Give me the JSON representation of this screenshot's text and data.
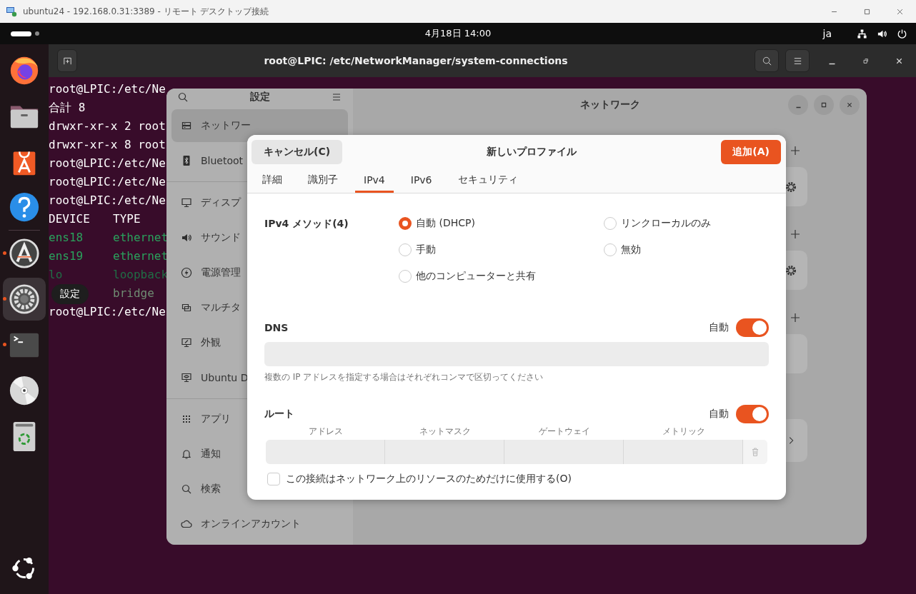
{
  "rdp_window": {
    "title": "ubuntu24 - 192.168.0.31:3389 - リモート デスクトップ接続"
  },
  "top_bar": {
    "clock": "4月18日 14:00",
    "input_method": "ja"
  },
  "dock": {
    "items": [
      {
        "kind": "firefox",
        "running": false,
        "selected": false
      },
      {
        "kind": "files",
        "running": false,
        "selected": false
      },
      {
        "kind": "app-center",
        "running": false,
        "selected": false
      },
      {
        "kind": "help",
        "running": false,
        "selected": false
      },
      {
        "kind": "updater",
        "running": true,
        "selected": false
      },
      {
        "kind": "settings",
        "running": true,
        "selected": true
      },
      {
        "kind": "terminal",
        "running": true,
        "selected": false
      },
      {
        "kind": "disc",
        "running": false,
        "selected": false
      },
      {
        "kind": "trash",
        "running": false,
        "selected": false
      }
    ],
    "tooltip": "設定"
  },
  "terminal": {
    "title": "root@LPIC: /etc/NetworkManager/system-connections",
    "lines": [
      {
        "kind": "text",
        "text": "root@LPIC:/etc/Ne"
      },
      {
        "kind": "text",
        "text": "合計 8"
      },
      {
        "kind": "text",
        "text": "drwxr-xr-x 2 root"
      },
      {
        "kind": "text",
        "text": "drwxr-xr-x 8 root"
      },
      {
        "kind": "text",
        "text": "root@LPIC:/etc/Ne"
      },
      {
        "kind": "text",
        "text": "root@LPIC:/etc/Ne"
      },
      {
        "kind": "text",
        "text": "root@LPIC:/etc/Ne"
      },
      {
        "kind": "row",
        "device": "DEVICE",
        "type": "TYPE"
      },
      {
        "kind": "row",
        "device": "ens18",
        "type": "ethernet",
        "color": "#2aa15c"
      },
      {
        "kind": "row",
        "device": "ens19",
        "type": "ethernet",
        "color": "#2aa15c"
      },
      {
        "kind": "row",
        "device": "lo",
        "type": "loopback",
        "color": "#1f6e45"
      },
      {
        "kind": "row",
        "type": "bridge",
        "color": "#6f8c72"
      },
      {
        "kind": "text",
        "text": "root@LPIC:/etc/Ne"
      }
    ]
  },
  "settings": {
    "title": "設定",
    "page_title": "ネットワーク",
    "sidebar": {
      "sections": [
        {
          "items": [
            {
              "kind": "network",
              "label": "ネットワー",
              "selected": true
            },
            {
              "kind": "bluetooth",
              "label": "Bluetoot",
              "selected": false
            }
          ]
        },
        {
          "items": [
            {
              "kind": "display",
              "label": "ディスプ",
              "selected": false
            },
            {
              "kind": "sound",
              "label": "サウンド",
              "selected": false
            },
            {
              "kind": "power",
              "label": "電源管理",
              "selected": false
            },
            {
              "kind": "multitask",
              "label": "マルチタ",
              "selected": false
            },
            {
              "kind": "appearance",
              "label": "外観",
              "selected": false
            },
            {
              "kind": "desktop",
              "label": "Ubuntu D",
              "selected": false
            }
          ]
        },
        {
          "items": [
            {
              "kind": "apps",
              "label": "アプリ",
              "selected": false
            },
            {
              "kind": "notifications",
              "label": "通知",
              "selected": false
            },
            {
              "kind": "search",
              "label": "検索",
              "selected": false
            },
            {
              "kind": "online",
              "label": "オンラインアカウント",
              "selected": false
            }
          ]
        }
      ]
    },
    "cards": [
      {
        "kind": "gear"
      },
      {
        "kind": "gear"
      },
      {
        "kind": "plain"
      },
      {
        "kind": "chevron"
      }
    ]
  },
  "dialog": {
    "cancel": "キャンセル(C)",
    "title": "新しいプロファイル",
    "confirm": "追加(A)",
    "tabs": [
      {
        "label": "詳細",
        "selected": false
      },
      {
        "label": "識別子",
        "selected": false
      },
      {
        "label": "IPv4",
        "selected": true
      },
      {
        "label": "IPv6",
        "selected": false
      },
      {
        "label": "セキュリティ",
        "selected": false
      }
    ],
    "ipv4_method": {
      "label": "IPv4 メソッド(4)",
      "options": [
        {
          "label": "自動 (DHCP)",
          "selected": true
        },
        {
          "label": "リンクローカルのみ",
          "selected": false
        },
        {
          "label": "手動",
          "selected": false
        },
        {
          "label": "無効",
          "selected": false
        },
        {
          "label": "他のコンピューターと共有",
          "selected": false
        }
      ]
    },
    "dns": {
      "label": "DNS",
      "auto_label": "自動",
      "on": true,
      "hint": "複数の IP アドレスを指定する場合はそれぞれコンマで区切ってください"
    },
    "routes": {
      "label": "ルート",
      "auto_label": "自動",
      "on": true,
      "columns": [
        "アドレス",
        "ネットマスク",
        "ゲートウェイ",
        "メトリック"
      ]
    },
    "checkbox": {
      "label": "この接続はネットワーク上のリソースのためだけに使用する(O)",
      "checked": false
    }
  }
}
